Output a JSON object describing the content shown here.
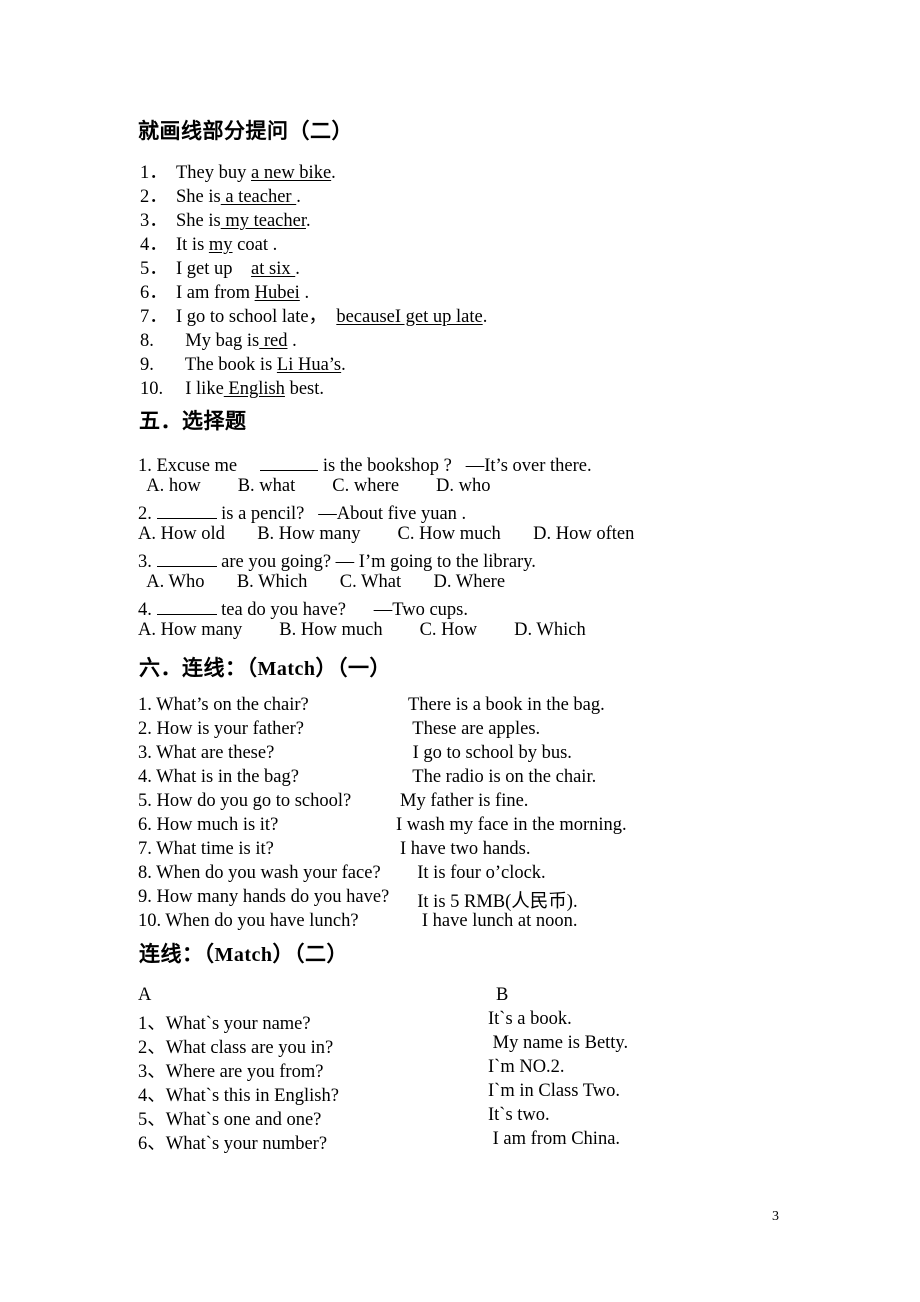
{
  "document": {
    "page_number": "3"
  },
  "section_underline_questions": {
    "heading": "就画线部分提问（二）",
    "items": [
      {
        "num": "1．",
        "pre": "They buy ",
        "underlined": "a new bike",
        "post": "."
      },
      {
        "num": "2．",
        "pre": "She is",
        "underlined": " a teacher ",
        "post": "."
      },
      {
        "num": "3．",
        "pre": "She is",
        "underlined": " my teacher",
        "post": "."
      },
      {
        "num": "4．",
        "pre": "It is ",
        "underlined": "my",
        "post": " coat ."
      },
      {
        "num": "5．",
        "pre": "I get up    ",
        "underlined": "at six ",
        "post": "."
      },
      {
        "num": "6．",
        "pre": "I am from ",
        "underlined": "Hubei",
        "post": " ."
      },
      {
        "num": "7．",
        "pre": "I go to school late，  ",
        "underlined": "becauseI get up late",
        "post": "."
      },
      {
        "num": "8.",
        "pre": "  My bag is",
        "underlined": " red",
        "post": " ."
      },
      {
        "num": "9.",
        "pre": "  The book is ",
        "underlined": "Li Hua’s",
        "post": "."
      },
      {
        "num": "10.",
        "pre": "  I like",
        "underlined": " English",
        "post": " best."
      }
    ]
  },
  "section_five": {
    "heading_cjk": "五．选择题",
    "questions": [
      {
        "stem_pre": "1. Excuse me     ",
        "stem_post": " is the bookshop ?   —It’s over there.",
        "options_line": "  A. how        B. what        C. where        D. who"
      },
      {
        "stem_pre": "2. ",
        "stem_post": " is a pencil?   —About five yuan .",
        "options_line": "A. How old       B. How many        C. How much       D. How often"
      },
      {
        "stem_pre": "3. ",
        "stem_post": " are you going? — I’m going to the library.",
        "options_line": "  A. Who       B. Which       C. What       D. Where"
      },
      {
        "stem_pre": "4. ",
        "stem_post": " tea do you have?      —Two cups.",
        "options_line": "A. How many        B. How much        C. How        D. Which"
      }
    ]
  },
  "section_six": {
    "heading_prefix": "六．连线：（",
    "heading_latin": "Match",
    "heading_suffix": "）（一）",
    "pairs": [
      {
        "left": "1. What’s on the chair?",
        "right": "There is a book in the bag."
      },
      {
        "left": "2. How is your father?",
        "right": " These are apples."
      },
      {
        "left": "3. What are these?",
        "right": " I go to school by bus."
      },
      {
        "left": "4. What is in the bag?",
        "right": " The radio is on the chair."
      },
      {
        "left": "5. How do you go to school?",
        "right": "My father is fine."
      },
      {
        "left": "6. How much is it?",
        "right": "I wash my face in the morning."
      },
      {
        "left": "7. What time is it?",
        "right": "I have two hands."
      },
      {
        "left": "8. When do you wash your face?",
        "right": "  It is four o’clock."
      },
      {
        "left": "9. How many hands do you have?",
        "right": "  It is 5 RMB(人民币)."
      },
      {
        "left": "10. When do you have lunch?",
        "right": "   I have lunch at noon."
      }
    ]
  },
  "section_match_two": {
    "heading_prefix": "连线：（",
    "heading_latin": "Match",
    "heading_suffix": "）（二）",
    "column_a_label": "A",
    "column_b_label": "B",
    "pairs": [
      {
        "left": "1、What`s your name?",
        "right": "It`s a book."
      },
      {
        "left": "2、What class are you in?",
        "right": " My name is Betty."
      },
      {
        "left": "3、Where are you from?",
        "right": "I`m NO.2."
      },
      {
        "left": "4、What`s this in English?",
        "right": "I`m in Class Two."
      },
      {
        "left": "5、What`s one and one?",
        "right": "It`s two."
      },
      {
        "left": "6、What`s your number?",
        "right": " I am from China."
      }
    ]
  }
}
